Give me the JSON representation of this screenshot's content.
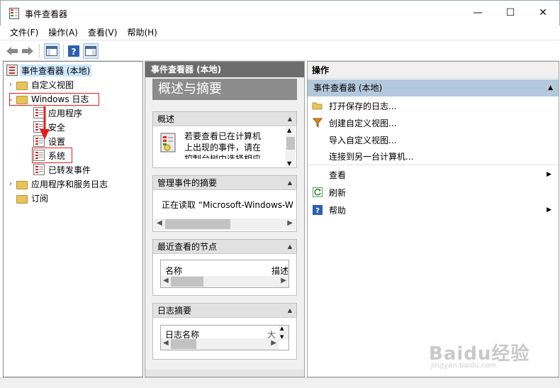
{
  "window": {
    "title": "事件查看器",
    "controls": {
      "minimize": "—",
      "maximize": "☐",
      "close": "✕"
    }
  },
  "menu": [
    "文件(F)",
    "操作(A)",
    "查看(V)",
    "帮助(H)"
  ],
  "tree": {
    "root": "事件查看器 (本地)",
    "custom_views": "自定义视图",
    "windows_logs": "Windows 日志",
    "app_log": "应用程序",
    "security_log": "安全",
    "setup_log": "设置",
    "system_log": "系统",
    "forwarded_log": "已转发事件",
    "app_service_logs": "应用程序和服务日志",
    "subscriptions": "订阅"
  },
  "middle": {
    "header": "事件查看器 (本地)",
    "title": "概述与摘要",
    "overview": {
      "heading": "概述",
      "text_line1": "若要查看已在计算机",
      "text_line2": "上出现的事件，请在",
      "text_line3": "控制台树中选择相应"
    },
    "summary": {
      "heading": "管理事件的摘要",
      "text": "正在读取 “Microsoft-Windows-W"
    },
    "recent": {
      "heading": "最近查看的节点",
      "col_name": "名称",
      "col_desc": "描述"
    },
    "log_summary": {
      "heading": "日志摘要",
      "col_name": "日志名称",
      "col_extra": "大"
    }
  },
  "right": {
    "header": "操作",
    "group": "事件查看器 (本地)",
    "actions": [
      {
        "label": "打开保存的日志...",
        "icon": "folder-open-icon"
      },
      {
        "label": "创建自定义视图...",
        "icon": "filter-icon"
      },
      {
        "label": "导入自定义视图...",
        "icon": ""
      },
      {
        "label": "连接到另一台计算机...",
        "icon": ""
      },
      {
        "label": "查看",
        "icon": ""
      },
      {
        "label": "刷新",
        "icon": "refresh-icon"
      },
      {
        "label": "帮助",
        "icon": "help-icon"
      }
    ]
  },
  "watermark": {
    "brand": "Baidu经验",
    "url": "jingyan.baidu.com"
  }
}
